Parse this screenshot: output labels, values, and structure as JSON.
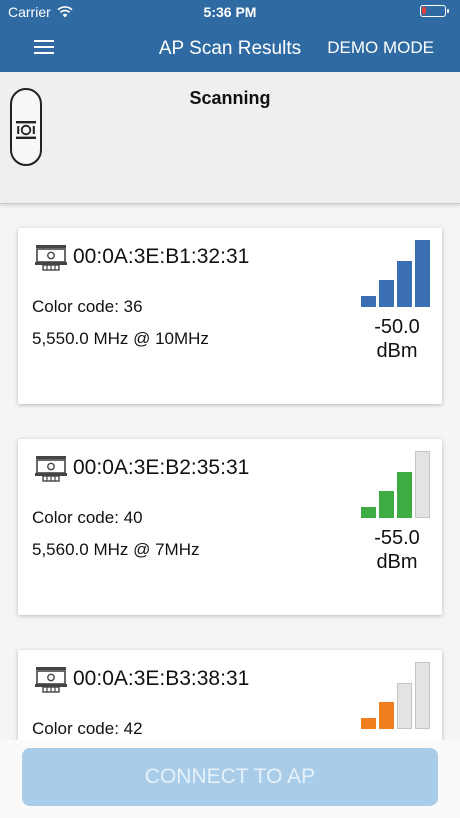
{
  "status_bar": {
    "carrier": "Carrier",
    "time": "5:36 PM"
  },
  "nav": {
    "title": "AP Scan Results",
    "demo_mode": "DEMO MODE"
  },
  "scan": {
    "label": "Scanning"
  },
  "access_points": [
    {
      "mac": "00:0A:3E:B1:32:31",
      "color_code": "Color code: 36",
      "frequency": "5,550.0 MHz @ 10MHz",
      "signal_value": "-50.0",
      "signal_unit": "dBm",
      "signal_bars_filled": 4,
      "bar_color": "#3b6fb3"
    },
    {
      "mac": "00:0A:3E:B2:35:31",
      "color_code": "Color code: 40",
      "frequency": "5,560.0 MHz @ 7MHz",
      "signal_value": "-55.0",
      "signal_unit": "dBm",
      "signal_bars_filled": 3,
      "bar_color": "#3cac43"
    },
    {
      "mac": "00:0A:3E:B3:38:31",
      "color_code": "Color code: 42",
      "frequency": "",
      "signal_value": "",
      "signal_unit": "",
      "signal_bars_filled": 2,
      "bar_color": "#f07d1e"
    }
  ],
  "actions": {
    "connect_label": "CONNECT TO AP"
  },
  "colors": {
    "header": "#2f6aa3",
    "battery_low": "#e0403a",
    "connect_disabled": "#a9cde9"
  }
}
